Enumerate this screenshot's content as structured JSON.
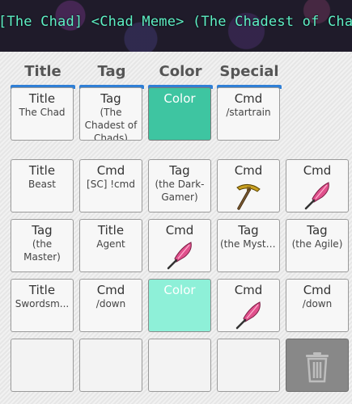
{
  "banner": {
    "text": "[The Chad] <Chad Meme> (The Chadest of Chads) : Is"
  },
  "headers": [
    "Title",
    "Tag",
    "Color",
    "Special"
  ],
  "colors": {
    "header_bar": "#2f7fd6",
    "color_slot_1": "#3ec5a1",
    "color_slot_2": "#8ef0d8",
    "trash_bg": "#888888"
  },
  "equipped": [
    {
      "type": "Title",
      "value": "The Chad"
    },
    {
      "type": "Tag",
      "value": "(The Chadest of Chads)"
    },
    {
      "type": "Color",
      "value": ""
    },
    {
      "type": "Cmd",
      "value": "/startrain"
    }
  ],
  "grid": [
    [
      {
        "type": "Title",
        "value": "Beast"
      },
      {
        "type": "Cmd",
        "value": "[SC] !cmd"
      },
      {
        "type": "Tag",
        "value": "(the Dark-Gamer)"
      },
      {
        "type": "Cmd",
        "icon": "pickaxe-icon"
      },
      {
        "type": "Cmd",
        "icon": "feather-quill-icon"
      }
    ],
    [
      {
        "type": "Tag",
        "value": "(the Master)"
      },
      {
        "type": "Title",
        "value": "Agent"
      },
      {
        "type": "Cmd",
        "icon": "feather-quill-icon"
      },
      {
        "type": "Tag",
        "value": "(the Mysterio..."
      },
      {
        "type": "Tag",
        "value": "(the Agile)"
      }
    ],
    [
      {
        "type": "Title",
        "value": "Swordsm..."
      },
      {
        "type": "Cmd",
        "value": "/down"
      },
      {
        "type": "Color",
        "value": ""
      },
      {
        "type": "Cmd",
        "icon": "feather-quill-icon"
      },
      {
        "type": "Cmd",
        "value": "/down"
      }
    ]
  ],
  "trash": {
    "icon": "trash-icon"
  }
}
